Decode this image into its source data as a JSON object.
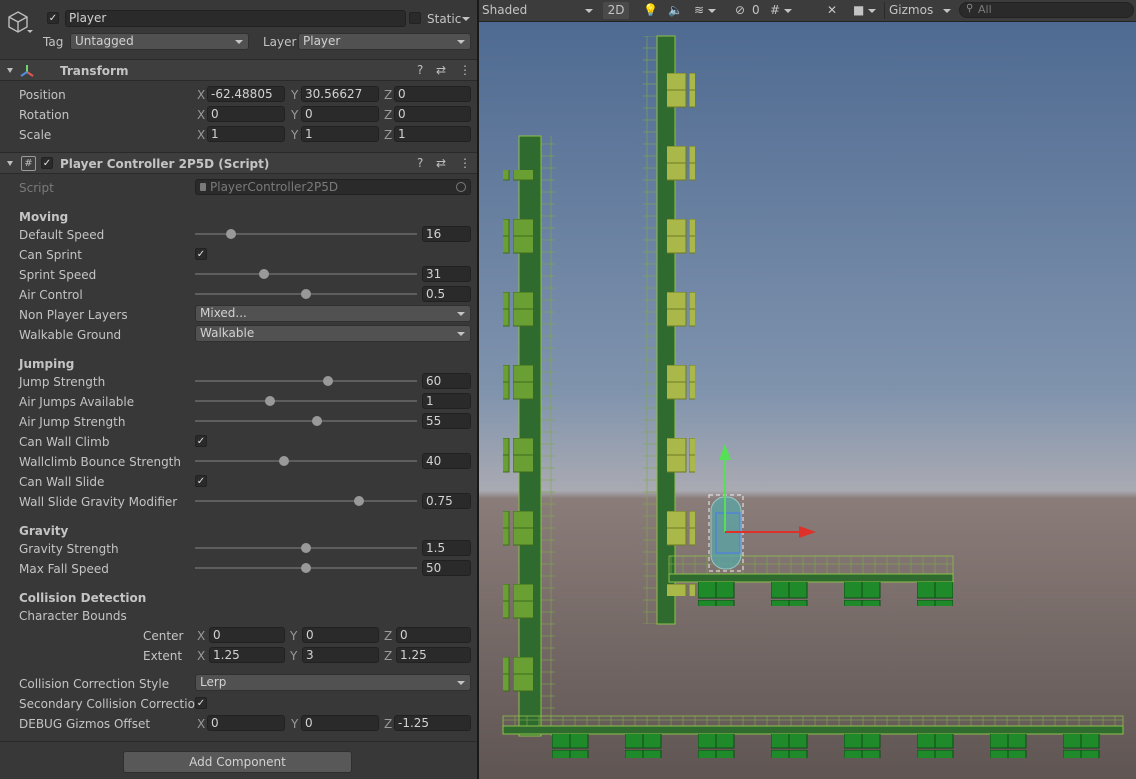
{
  "object": {
    "name": "Player",
    "static_label": "Static",
    "tag_label": "Tag",
    "tag_value": "Untagged",
    "layer_label": "Layer",
    "layer_value": "Player"
  },
  "transform": {
    "title": "Transform",
    "position": {
      "label": "Position",
      "x": "-62.48805",
      "y": "30.56627",
      "z": "0"
    },
    "rotation": {
      "label": "Rotation",
      "x": "0",
      "y": "0",
      "z": "0"
    },
    "scale": {
      "label": "Scale",
      "x": "1",
      "y": "1",
      "z": "1"
    }
  },
  "axes": {
    "x": "X",
    "y": "Y",
    "z": "Z"
  },
  "component": {
    "title": "Player Controller 2P5D (Script)",
    "script_label": "Script",
    "script_value": "PlayerController2P5D"
  },
  "moving": {
    "header": "Moving",
    "default_speed": {
      "label": "Default Speed",
      "value": "16",
      "level": 0.16
    },
    "can_sprint": {
      "label": "Can Sprint",
      "checked": true
    },
    "sprint_speed": {
      "label": "Sprint Speed",
      "value": "31",
      "level": 0.31
    },
    "air_control": {
      "label": "Air Control",
      "value": "0.5",
      "level": 0.5
    },
    "non_player_layers": {
      "label": "Non Player Layers",
      "value": "Mixed..."
    },
    "walkable_ground": {
      "label": "Walkable Ground",
      "value": "Walkable"
    }
  },
  "jumping": {
    "header": "Jumping",
    "jump_strength": {
      "label": "Jump Strength",
      "value": "60",
      "level": 0.6
    },
    "air_jumps": {
      "label": "Air Jumps Available",
      "value": "1",
      "level": 0.34
    },
    "air_jump_strength": {
      "label": "Air Jump Strength",
      "value": "55",
      "level": 0.55
    },
    "can_wall_climb": {
      "label": "Can Wall Climb",
      "checked": true
    },
    "wallclimb_bounce": {
      "label": "Wallclimb Bounce Strength",
      "value": "40",
      "level": 0.4
    },
    "can_wall_slide": {
      "label": "Can Wall Slide",
      "checked": true
    },
    "wall_slide_gravity": {
      "label": "Wall Slide Gravity Modifier",
      "value": "0.75",
      "level": 0.74
    }
  },
  "gravity": {
    "header": "Gravity",
    "gravity_strength": {
      "label": "Gravity Strength",
      "value": "1.5",
      "level": 0.5
    },
    "max_fall_speed": {
      "label": "Max Fall Speed",
      "value": "50",
      "level": 0.5
    }
  },
  "collision": {
    "header": "Collision Detection",
    "character_bounds": "Character Bounds",
    "center": {
      "label": "Center",
      "x": "0",
      "y": "0",
      "z": "0"
    },
    "extent": {
      "label": "Extent",
      "x": "1.25",
      "y": "3",
      "z": "1.25"
    },
    "correction_style": {
      "label": "Collision Correction Style",
      "value": "Lerp"
    },
    "secondary": {
      "label": "Secondary Collision Correction",
      "checked": true
    },
    "debug_offset": {
      "label": "DEBUG Gizmos Offset",
      "x": "0",
      "y": "0",
      "z": "-1.25"
    }
  },
  "add_component": "Add Component",
  "scene_toolbar": {
    "shading": "Shaded",
    "mode_2d": "2D",
    "hidden_count": "0",
    "gizmos": "Gizmos",
    "search_placeholder": "All"
  },
  "icons": [
    "gameobject-cube-icon",
    "transform-icon",
    "script-hash-icon",
    "help-icon",
    "preset-icon",
    "menu-kebab-icon",
    "light-icon",
    "audio-icon",
    "effects-icon",
    "visibility-icon",
    "grid-icon",
    "tools-icon",
    "camera-icon",
    "search-icon"
  ],
  "colors": {
    "panel_bg": "#383838",
    "field_bg": "#2a2a2a",
    "sky_top": "#4e6a91",
    "ground": "#6f6461",
    "accent_green": "#2e8b2e",
    "gizmo_red": "#e0302a",
    "gizmo_green": "#55e055"
  }
}
